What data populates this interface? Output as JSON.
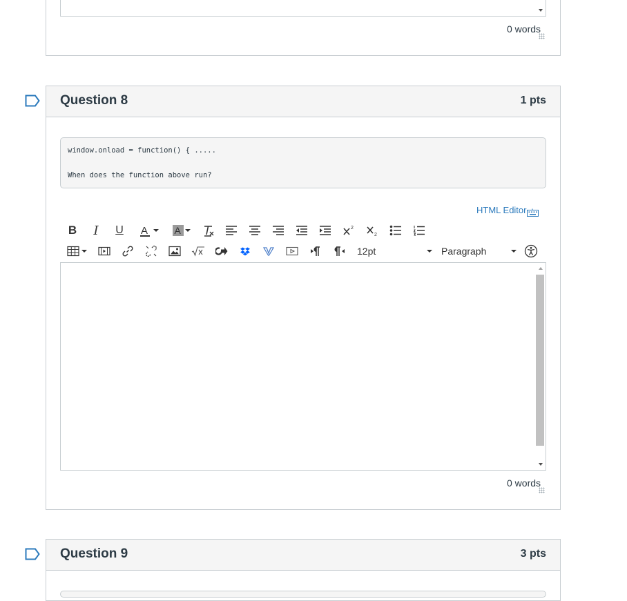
{
  "previous_question": {
    "word_count": "0 words"
  },
  "question8": {
    "title": "Question 8",
    "points": "1 pts",
    "code_line": "window.onload = function() { .....",
    "prompt_line": "When does the function above run?",
    "html_editor_label": "HTML Editor",
    "font_size": "12pt",
    "block_format": "Paragraph",
    "word_count": "0 words"
  },
  "question9": {
    "title": "Question 9",
    "points": "3 pts"
  },
  "colors": {
    "link": "#2b7abc",
    "flag": "#2b7abc",
    "header_bg": "#f5f5f5",
    "border": "#c7cdd1"
  },
  "icons": [
    "flag-icon",
    "bold-icon",
    "italic-icon",
    "underline-icon",
    "text-color-icon",
    "background-color-icon",
    "clear-formatting-icon",
    "align-left-icon",
    "align-center-icon",
    "align-right-icon",
    "outdent-icon",
    "indent-icon",
    "superscript-icon",
    "subscript-icon",
    "bullet-list-icon",
    "numbered-list-icon",
    "table-icon",
    "media-icon",
    "link-icon",
    "unlink-icon",
    "image-icon",
    "math-icon",
    "lti-tool-icon",
    "dropbox-icon",
    "vimeo-icon",
    "embed-media-icon",
    "ltr-icon",
    "rtl-icon",
    "accessibility-icon",
    "keyboard-icon"
  ]
}
